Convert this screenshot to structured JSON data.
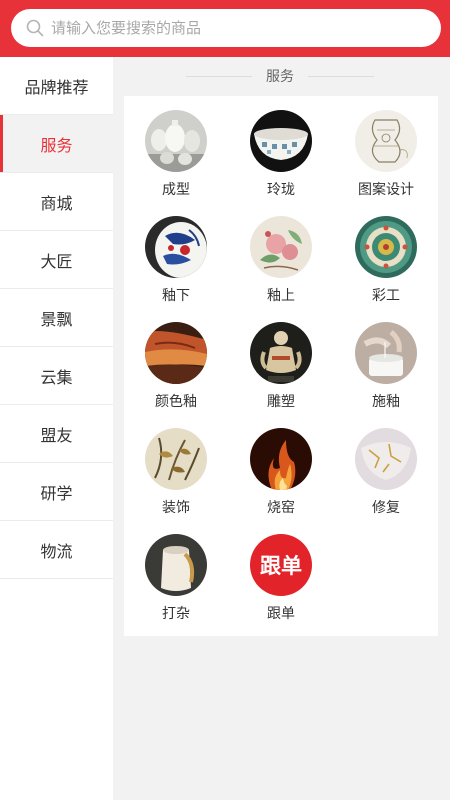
{
  "search": {
    "placeholder": "请输入您要搜索的商品"
  },
  "sidebar": {
    "items": [
      {
        "label": "品牌推荐"
      },
      {
        "label": "服务"
      },
      {
        "label": "商城"
      },
      {
        "label": "大匠"
      },
      {
        "label": "景飘"
      },
      {
        "label": "云集"
      },
      {
        "label": "盟友"
      },
      {
        "label": "研学"
      },
      {
        "label": "物流"
      }
    ],
    "active_index": 1
  },
  "section": {
    "title": "服务"
  },
  "services": [
    {
      "label": "成型"
    },
    {
      "label": "玲珑"
    },
    {
      "label": "图案设计"
    },
    {
      "label": "釉下"
    },
    {
      "label": "釉上"
    },
    {
      "label": "彩工"
    },
    {
      "label": "颜色釉"
    },
    {
      "label": "雕塑"
    },
    {
      "label": "施釉"
    },
    {
      "label": "装饰"
    },
    {
      "label": "烧窑"
    },
    {
      "label": "修复"
    },
    {
      "label": "打杂"
    },
    {
      "label": "跟单",
      "thumb_text": "跟单"
    }
  ],
  "colors": {
    "accent": "#e8323a",
    "background": "#f2f2f2"
  }
}
